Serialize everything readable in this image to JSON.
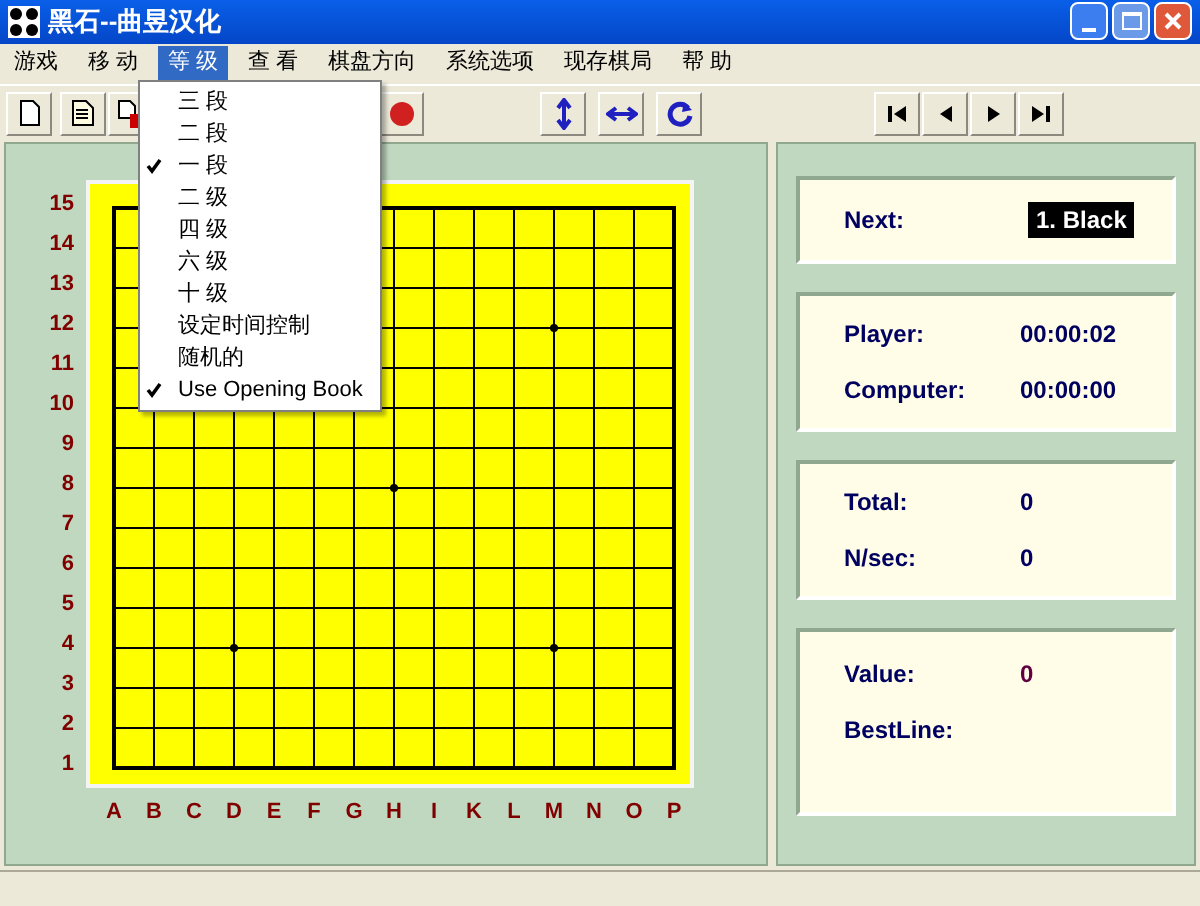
{
  "window": {
    "title": "黑石--曲昱汉化"
  },
  "menu_bar": [
    {
      "label": "游戏",
      "selected": false
    },
    {
      "label": "移 动",
      "selected": false
    },
    {
      "label": "等 级",
      "selected": true
    },
    {
      "label": "查 看",
      "selected": false
    },
    {
      "label": "棋盘方向",
      "selected": false
    },
    {
      "label": "系统选项",
      "selected": false
    },
    {
      "label": "现存棋局",
      "selected": false
    },
    {
      "label": "帮 助",
      "selected": false
    }
  ],
  "dropdown": [
    {
      "label": "三 段",
      "checked": false
    },
    {
      "label": "二 段",
      "checked": false
    },
    {
      "label": "一 段",
      "checked": true
    },
    {
      "label": "二 级",
      "checked": false
    },
    {
      "label": "四 级",
      "checked": false
    },
    {
      "label": "六 级",
      "checked": false
    },
    {
      "label": "十 级",
      "checked": false
    },
    {
      "label": "设定时间控制",
      "checked": false
    },
    {
      "label": "随机的",
      "checked": false
    },
    {
      "label": "Use Opening Book",
      "checked": true
    }
  ],
  "board": {
    "row_labels": [
      "15",
      "14",
      "13",
      "12",
      "11",
      "10",
      "9",
      "8",
      "7",
      "6",
      "5",
      "4",
      "3",
      "2",
      "1"
    ],
    "column_labels": [
      "A",
      "B",
      "C",
      "D",
      "E",
      "F",
      "G",
      "H",
      "I",
      "K",
      "L",
      "M",
      "N",
      "O",
      "P"
    ]
  },
  "panels": [
    {
      "rows": [
        {
          "label": "Next:",
          "value": "1. Black",
          "kind": "highlight"
        }
      ]
    },
    {
      "rows": [
        {
          "label": "Player:",
          "value": "00:00:02",
          "kind": "plain"
        },
        {
          "label": "Computer:",
          "value": "00:00:00",
          "kind": "plain"
        }
      ]
    },
    {
      "rows": [
        {
          "label": "Total:",
          "value": "0",
          "kind": "plain"
        },
        {
          "label": "N/sec:",
          "value": "0",
          "kind": "plain"
        }
      ]
    },
    {
      "rows": [
        {
          "label": "Value:",
          "value": "0",
          "kind": "score"
        },
        {
          "label": "BestLine:"
        }
      ]
    }
  ]
}
